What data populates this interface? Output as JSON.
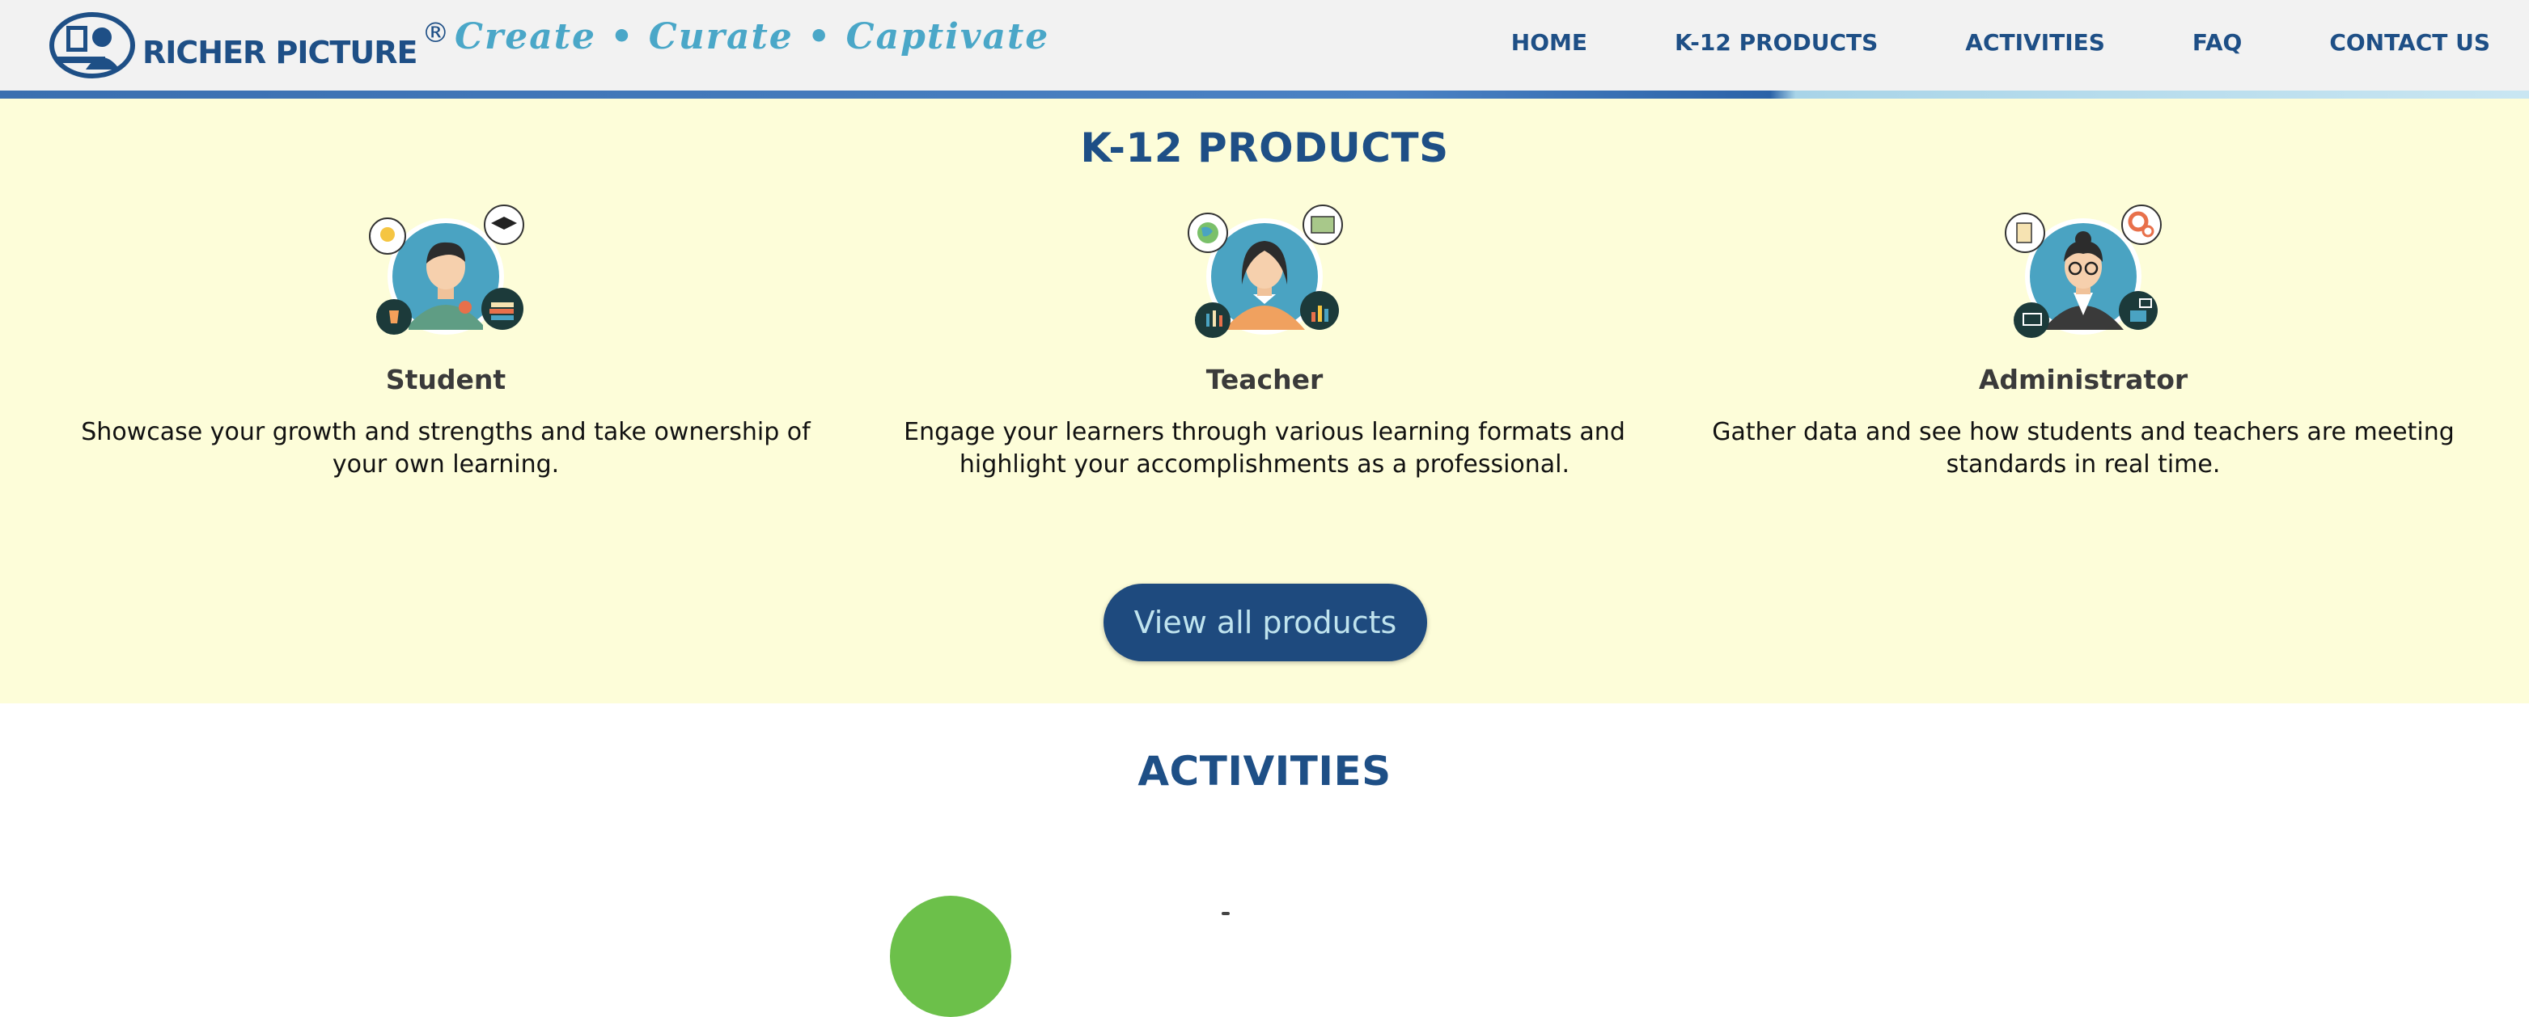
{
  "header": {
    "logo_text": "RICHER PICTURE",
    "logo_reg": "®",
    "tagline": "Create • Curate • Captivate",
    "nav": [
      {
        "label": "HOME"
      },
      {
        "label": "K-12 PRODUCTS"
      },
      {
        "label": "ACTIVITIES"
      },
      {
        "label": "FAQ"
      },
      {
        "label": "CONTACT US"
      }
    ]
  },
  "products": {
    "title": "K-12 PRODUCTS",
    "cards": [
      {
        "title": "Student",
        "desc": "Showcase your growth and strengths and take ownership of your own learning.",
        "icon": "student-avatar-icon"
      },
      {
        "title": "Teacher",
        "desc": "Engage your learners through various learning formats and highlight your accomplishments as a professional.",
        "icon": "teacher-avatar-icon"
      },
      {
        "title": "Administrator",
        "desc": "Gather data and see how students and teachers are meeting standards in real time.",
        "icon": "administrator-avatar-icon"
      }
    ],
    "button": "View all products"
  },
  "activities": {
    "title": "ACTIVITIES"
  },
  "colors": {
    "brand_navy": "#1e4f86",
    "tagline_blue": "#4aa7c8",
    "products_bg": "#fdfdd9",
    "avatar_teal": "#4aa3c2",
    "accent_green": "#6cc04a"
  }
}
